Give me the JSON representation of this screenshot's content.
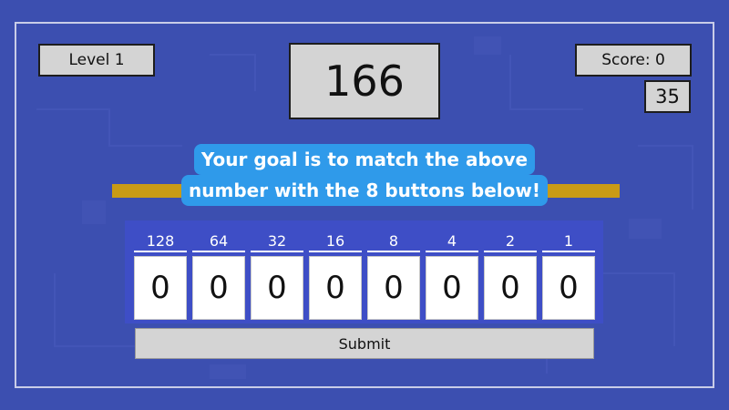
{
  "hud": {
    "level": "Level 1",
    "target": "166",
    "score": "Score: 0",
    "timer": "35"
  },
  "instruction": {
    "line1": "Your goal is to match the above",
    "line2": "number with the 8 buttons below!"
  },
  "bits": [
    {
      "label": "128",
      "value": "0"
    },
    {
      "label": "64",
      "value": "0"
    },
    {
      "label": "32",
      "value": "0"
    },
    {
      "label": "16",
      "value": "0"
    },
    {
      "label": "8",
      "value": "0"
    },
    {
      "label": "4",
      "value": "0"
    },
    {
      "label": "2",
      "value": "0"
    },
    {
      "label": "1",
      "value": "0"
    }
  ],
  "submit_label": "Submit",
  "colors": {
    "background": "#3c4fb0",
    "panel": "#3e4ec6",
    "instruction_bg": "#2f9aea",
    "gold_bar": "#c99b16",
    "box_gray": "#d4d4d4"
  }
}
